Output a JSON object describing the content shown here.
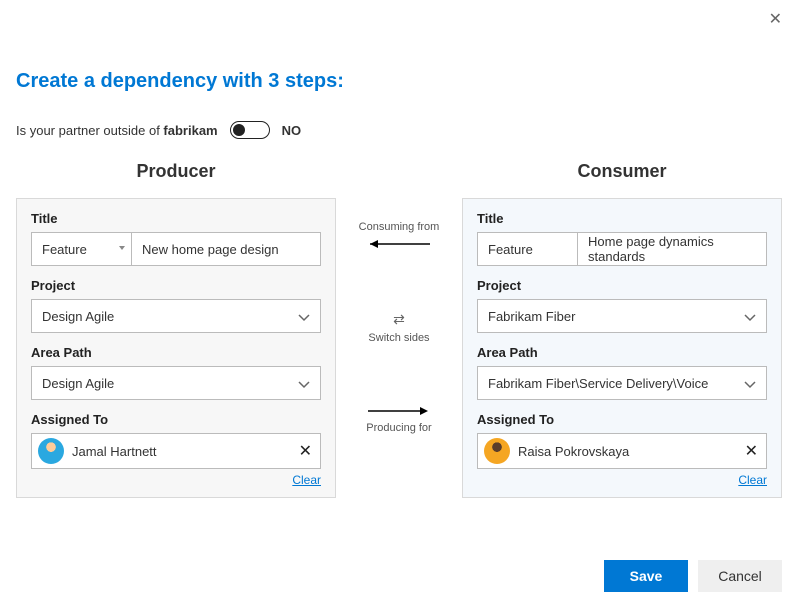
{
  "header": {
    "title": "Create a dependency with 3 steps:"
  },
  "partnerQuestion": {
    "prefix": "Is your partner outside of ",
    "org": "fabrikam",
    "toggleState": "NO"
  },
  "columns": {
    "producer": {
      "heading": "Producer",
      "titleLabel": "Title",
      "titleType": "Feature",
      "titleValue": "New home page design",
      "projectLabel": "Project",
      "project": "Design Agile",
      "areaLabel": "Area Path",
      "areaPath": "Design Agile",
      "assignedLabel": "Assigned To",
      "assignedTo": "Jamal Hartnett",
      "clear": "Clear"
    },
    "consumer": {
      "heading": "Consumer",
      "titleLabel": "Title",
      "titleType": "Feature",
      "titleValue": "Home page dynamics standards",
      "projectLabel": "Project",
      "project": "Fabrikam Fiber",
      "areaLabel": "Area Path",
      "areaPath": "Fabrikam Fiber\\Service Delivery\\Voice",
      "assignedLabel": "Assigned To",
      "assignedTo": "Raisa Pokrovskaya",
      "clear": "Clear"
    }
  },
  "middle": {
    "consumingFrom": "Consuming from",
    "switchSides": "Switch sides",
    "producingFor": "Producing for"
  },
  "footer": {
    "save": "Save",
    "cancel": "Cancel"
  }
}
